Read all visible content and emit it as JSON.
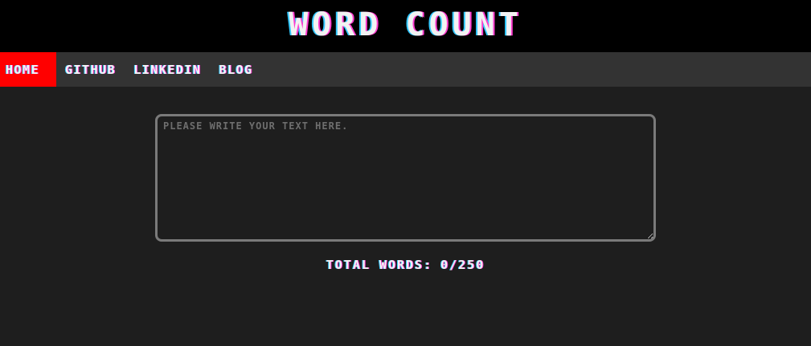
{
  "header": {
    "title": "WORD COUNT"
  },
  "nav": {
    "items": [
      {
        "label": "HOME",
        "active": true
      },
      {
        "label": "GITHUB",
        "active": false
      },
      {
        "label": "LINKEDIN",
        "active": false
      },
      {
        "label": "BLOG",
        "active": false
      }
    ]
  },
  "editor": {
    "placeholder": "PLEASE WRITE YOUR TEXT HERE.",
    "value": ""
  },
  "counter": {
    "label": "TOTAL WORDS:",
    "value": "0/250"
  },
  "colors": {
    "header_bg": "#000000",
    "nav_bg": "#333333",
    "active_nav": "#ff0000",
    "page_bg": "#1e1e1e",
    "textarea_border": "#7a7a7a"
  }
}
